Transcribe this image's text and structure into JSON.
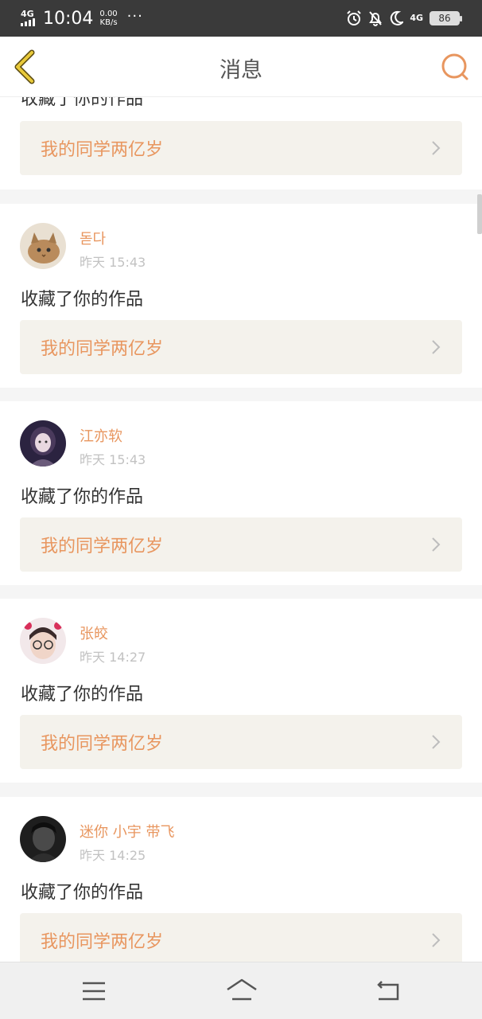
{
  "status_bar": {
    "network": "4G",
    "time": "10:04",
    "speed_value": "0.00",
    "speed_unit": "KB/s",
    "more": "···",
    "network2": "4G",
    "battery": "86"
  },
  "header": {
    "title": "消息",
    "back_icon": "chevron-left-icon",
    "search_icon": "search-icon"
  },
  "partial_top_card": {
    "action": "收藏了你的作品",
    "work_title": "我的同学两亿岁"
  },
  "notifications": [
    {
      "username": "돋다",
      "time": "昨天 15:43",
      "action": "收藏了你的作品",
      "work_title": "我的同学两亿岁",
      "avatar": "cat-avatar"
    },
    {
      "username": "江亦软",
      "time": "昨天 15:43",
      "action": "收藏了你的作品",
      "work_title": "我的同学两亿岁",
      "avatar": "girl-avatar"
    },
    {
      "username": "张皎",
      "time": "昨天 14:27",
      "action": "收藏了你的作品",
      "work_title": "我的同学两亿岁",
      "avatar": "glasses-girl-avatar"
    },
    {
      "username": "迷你 小宇 带飞",
      "time": "昨天 14:25",
      "action": "收藏了你的作品",
      "work_title": "我的同学两亿岁",
      "avatar": "dark-avatar"
    }
  ],
  "colors": {
    "accent": "#e8965f",
    "back_icon": "#e0c030",
    "card_bg": "#f4f2ec",
    "status_bar": "#3a3a3a"
  },
  "navbar": {
    "menu_icon": "menu-icon",
    "home_icon": "home-icon",
    "back_icon": "return-icon"
  }
}
